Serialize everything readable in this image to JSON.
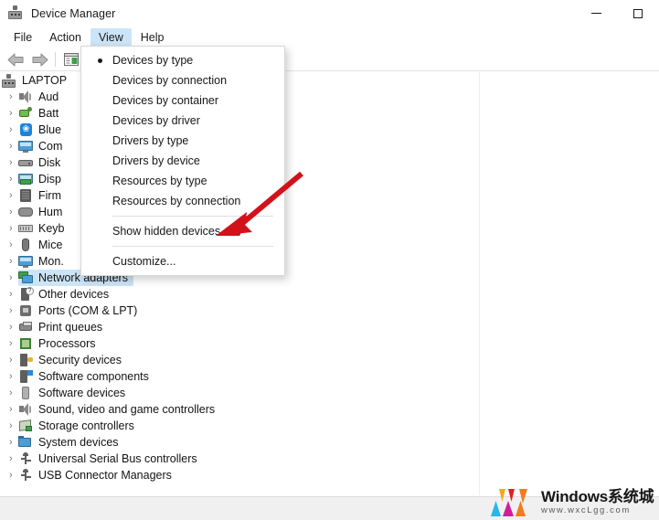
{
  "window": {
    "title": "Device Manager",
    "icon": "device-manager-icon",
    "controls": {
      "minimize": "—",
      "maximize": "□"
    }
  },
  "menubar": {
    "items": [
      {
        "label": "File",
        "active": false
      },
      {
        "label": "Action",
        "active": false
      },
      {
        "label": "View",
        "active": true
      },
      {
        "label": "Help",
        "active": false
      }
    ]
  },
  "toolbar": {
    "buttons": [
      {
        "name": "back-button",
        "icon": "left-arrow-icon"
      },
      {
        "name": "forward-button",
        "icon": "right-arrow-icon"
      },
      {
        "name": "properties-button",
        "icon": "properties-icon"
      }
    ]
  },
  "view_menu": {
    "items": [
      {
        "label": "Devices by type",
        "checked": true,
        "separator_after": false
      },
      {
        "label": "Devices by connection",
        "checked": false,
        "separator_after": false
      },
      {
        "label": "Devices by container",
        "checked": false,
        "separator_after": false
      },
      {
        "label": "Devices by driver",
        "checked": false,
        "separator_after": false
      },
      {
        "label": "Drivers by type",
        "checked": false,
        "separator_after": false
      },
      {
        "label": "Drivers by device",
        "checked": false,
        "separator_after": false
      },
      {
        "label": "Resources by type",
        "checked": false,
        "separator_after": false
      },
      {
        "label": "Resources by connection",
        "checked": false,
        "separator_after": true
      },
      {
        "label": "Show hidden devices",
        "checked": false,
        "separator_after": true
      },
      {
        "label": "Customize...",
        "checked": false,
        "separator_after": false
      }
    ]
  },
  "tree": {
    "root": {
      "label": "LAPTOP",
      "icon": "computer-icon",
      "expanded": true
    },
    "items": [
      {
        "label": "Aud",
        "icon": "audio-icon",
        "selected": false
      },
      {
        "label": "Batt",
        "icon": "battery-icon",
        "selected": false
      },
      {
        "label": "Blue",
        "icon": "bluetooth-icon",
        "selected": false
      },
      {
        "label": "Com",
        "icon": "computer-icon",
        "selected": false
      },
      {
        "label": "Disk",
        "icon": "disk-drive-icon",
        "selected": false
      },
      {
        "label": "Disp",
        "icon": "display-adapter-icon",
        "selected": false
      },
      {
        "label": "Firm",
        "icon": "firmware-icon",
        "selected": false
      },
      {
        "label": "Hum",
        "icon": "human-interface-icon",
        "selected": false
      },
      {
        "label": "Keyb",
        "icon": "keyboard-icon",
        "selected": false
      },
      {
        "label": "Mice",
        "icon": "mouse-icon",
        "selected": false
      },
      {
        "label": "Mon.",
        "icon": "monitor-icon",
        "selected": false
      },
      {
        "label": "Network adapters",
        "icon": "network-adapter-icon",
        "selected": true
      },
      {
        "label": "Other devices",
        "icon": "other-device-icon",
        "selected": false
      },
      {
        "label": "Ports (COM & LPT)",
        "icon": "port-icon",
        "selected": false
      },
      {
        "label": "Print queues",
        "icon": "printer-icon",
        "selected": false
      },
      {
        "label": "Processors",
        "icon": "processor-icon",
        "selected": false
      },
      {
        "label": "Security devices",
        "icon": "security-device-icon",
        "selected": false
      },
      {
        "label": "Software components",
        "icon": "software-component-icon",
        "selected": false
      },
      {
        "label": "Software devices",
        "icon": "software-device-icon",
        "selected": false
      },
      {
        "label": "Sound, video and game controllers",
        "icon": "audio-icon",
        "selected": false
      },
      {
        "label": "Storage controllers",
        "icon": "storage-controller-icon",
        "selected": false
      },
      {
        "label": "System devices",
        "icon": "system-device-icon",
        "selected": false
      },
      {
        "label": "Universal Serial Bus controllers",
        "icon": "usb-icon",
        "selected": false
      },
      {
        "label": "USB Connector Managers",
        "icon": "usb-icon",
        "selected": false
      }
    ]
  },
  "annotation": {
    "arrow": {
      "name": "red-arrow-annotation",
      "color": "#d3111a",
      "points_to": "Show hidden devices"
    }
  },
  "watermark": {
    "title": "Windows系统城",
    "url": "www.wxcLgg.com",
    "colors": [
      "#f5a623",
      "#e0201b",
      "#29b6e8",
      "#cc1f9c",
      "#f07c1e"
    ]
  },
  "colors": {
    "accent_selection": "#cce4f7",
    "menu_highlight": "#cce4f7",
    "annotation_red": "#d3111a",
    "window_bg": "#ffffff",
    "statusbar_bg": "#f0f0f0"
  }
}
